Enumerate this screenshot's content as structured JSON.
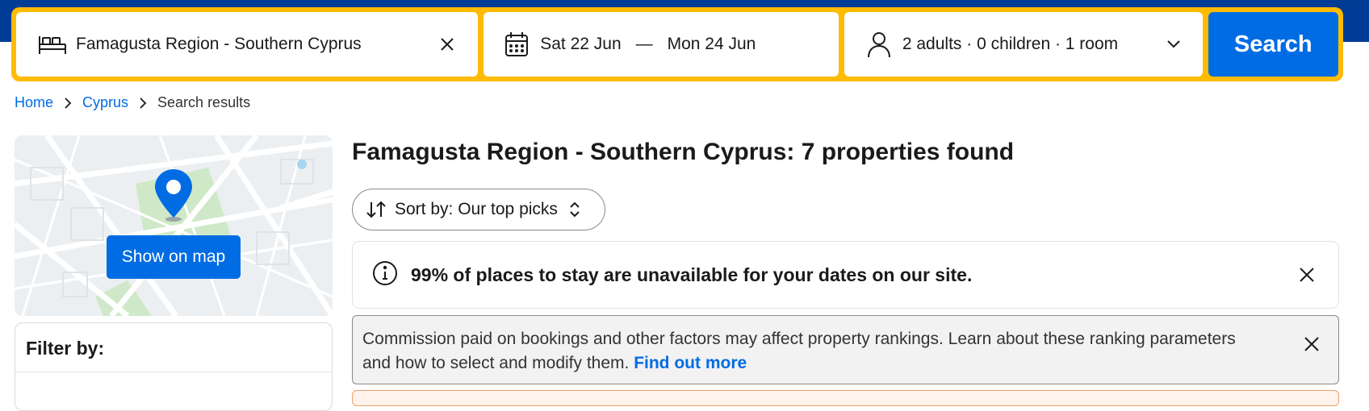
{
  "colors": {
    "brand_dark": "#003b95",
    "accent_yellow": "#febb02",
    "primary_blue": "#006ce4"
  },
  "search": {
    "destination": "Famagusta Region - Southern Cyprus",
    "destination_icon": "bed-icon",
    "clear_icon": "close-icon",
    "date_icon": "calendar-icon",
    "checkin": "Sat 22 Jun",
    "dash": "—",
    "checkout": "Mon 24 Jun",
    "occupancy_icon": "person-icon",
    "occupancy": "2 adults · 0 children · 1 room",
    "chevron_icon": "chevron-down-icon",
    "button_label": "Search"
  },
  "breadcrumb": {
    "items": [
      {
        "label": "Home",
        "link": true
      },
      {
        "label": "Cyprus",
        "link": true
      },
      {
        "label": "Search results",
        "link": false
      }
    ],
    "separator_icon": "chevron-right-icon"
  },
  "map": {
    "button_label": "Show on map",
    "pin_icon": "map-pin-icon"
  },
  "filters": {
    "title": "Filter by:"
  },
  "results": {
    "title": "Famagusta Region - Southern Cyprus: 7 properties found",
    "sort_label": "Sort by: Our top picks",
    "sort_icon": "sort-arrows-icon",
    "sort_toggle_icon": "chevron-up-down-icon"
  },
  "notice": {
    "icon": "info-icon",
    "text": "99% of places to stay are unavailable for your dates on our site.",
    "close_icon": "close-icon"
  },
  "commission": {
    "text": "Commission paid on bookings and other factors may affect property rankings. Learn about these ranking parameters and how to select and modify them. ",
    "link_label": "Find out more",
    "close_icon": "close-icon"
  }
}
